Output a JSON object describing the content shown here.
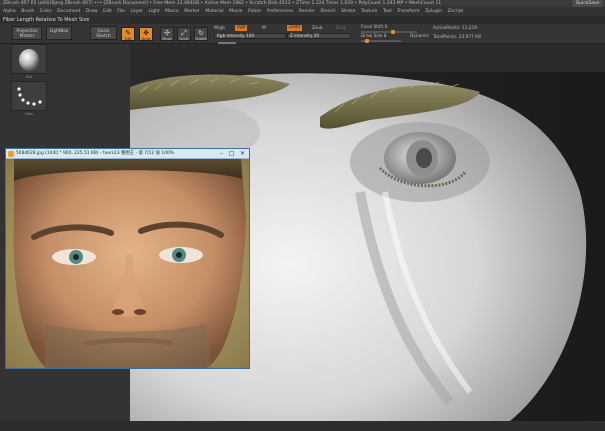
{
  "app": {
    "title": "ZBrush 4R7 P2 (x64)(Bjorg ZBrush 4R7) ••• [ZBrush Document]     •  Free Mem 13.484GB  •  Active Mem 1982  •  Scratch Disk 4513  •  ZTime 1.124  Timer 1.029  •  PolyCount 1.243 MP  •  MeshCount 11",
    "quicksave": "QuickSave"
  },
  "menu": [
    "Alpha",
    "Brush",
    "Color",
    "Document",
    "Draw",
    "Edit",
    "File",
    "Layer",
    "Light",
    "Macro",
    "Marker",
    "Material",
    "Movie",
    "Picker",
    "Preferences",
    "Render",
    "Stencil",
    "Stroke",
    "Texture",
    "Tool",
    "Transform",
    "Zplugin",
    "Zscript"
  ],
  "toolbar": {
    "subtitle": "Fiber Length Relative To Mesh Size",
    "projection_master": "Projection Master",
    "lightbox": "LightBox",
    "quick_sketch": "Quick Sketch",
    "edit": "Edit",
    "draw": "Draw",
    "move": "Move",
    "scale": "Scale",
    "rotate": "Rotate",
    "mrgb": "Mrgb",
    "rgb": "Rgb",
    "m": "M",
    "zadd": "Zadd",
    "zsub": "Zsub",
    "zcut": "Zcut",
    "rgb_intensity": "Rgb Intensity 100",
    "z_intensity": "Z Intensity 20",
    "focal_shift": "Focal Shift 0",
    "draw_size": "Draw Size 8",
    "dynamic": "Dynamic",
    "active_points": "ActivePoints: 11,219",
    "total_points": "TotalPoints: 23.977 Mil"
  },
  "left_panel": {
    "tile1_label": "Std",
    "tile2_label": "Dots"
  },
  "viewer": {
    "title": "5484628.jpg (1440 * 900, 225.51 KB) - fuers13 看图王 - 第 7/12 张 100%",
    "minimize": "–",
    "maximize": "□",
    "close": "✕"
  },
  "colors": {
    "accent": "#e38a2a",
    "viewer_frame": "#3a6fa0"
  },
  "icons": [
    "sphere-icon",
    "dots-stroke-icon",
    "edit-icon",
    "draw-icon",
    "move-icon",
    "scale-icon",
    "rotate-icon",
    "picture-icon"
  ]
}
